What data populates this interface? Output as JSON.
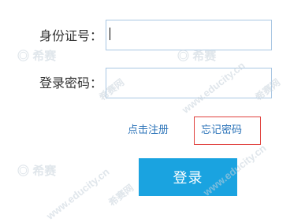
{
  "form": {
    "id_label": "身份证号：",
    "id_value": "",
    "password_label": "登录密码：",
    "password_value": "",
    "register_link": "点击注册",
    "forgot_link": "忘记密码",
    "login_button": "登录"
  },
  "watermark": {
    "logo_text": "希赛",
    "url_text": "www.educity.cn",
    "cjk_text": "希赛网"
  },
  "colors": {
    "accent": "#1aa3e0",
    "link": "#2b73b8",
    "highlight_border": "#e0403c",
    "input_border": "#a9c7e3"
  }
}
